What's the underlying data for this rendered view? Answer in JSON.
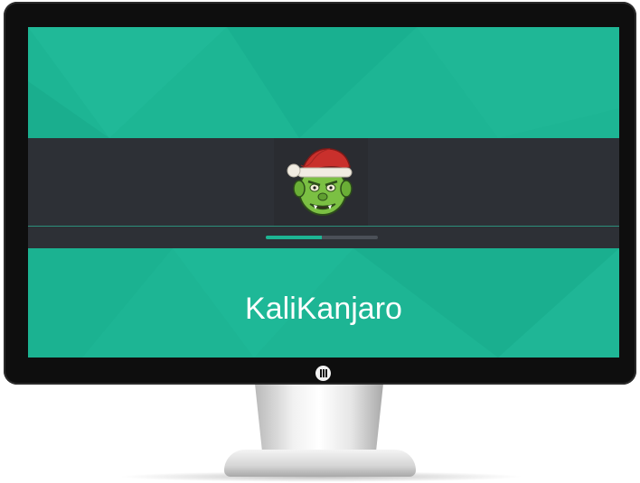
{
  "login_screen": {
    "hostname": "KaliKanjaro",
    "progress": 0.5,
    "accent_color": "#1db594",
    "band_color": "#2d3036"
  },
  "icons": {
    "avatar": "troll-santa-hat-avatar",
    "power": "monitor-power-button-icon"
  }
}
